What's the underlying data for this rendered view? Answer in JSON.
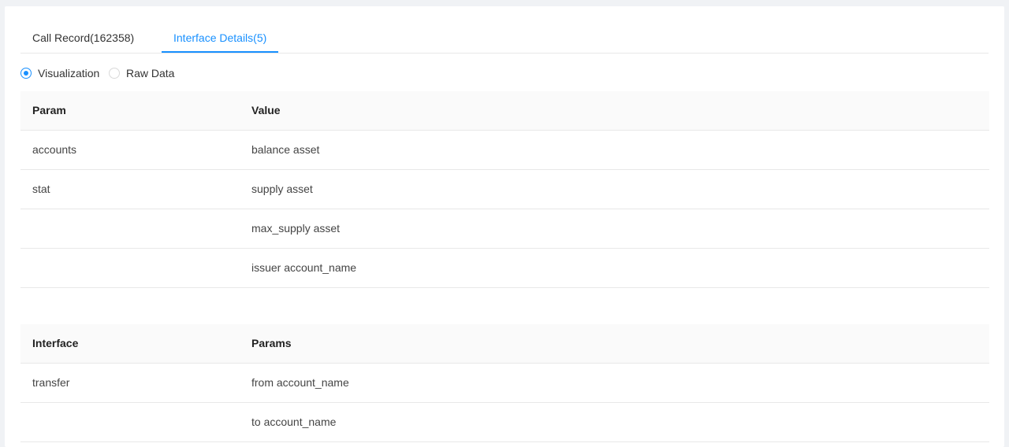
{
  "tabs": [
    {
      "label": "Call Record(162358)",
      "active": false
    },
    {
      "label": "Interface Details(5)",
      "active": true
    }
  ],
  "view_mode": {
    "options": [
      "Visualization",
      "Raw Data"
    ],
    "selected": "Visualization"
  },
  "params_table": {
    "headers": [
      "Param",
      "Value"
    ],
    "rows": [
      [
        "accounts",
        "balance asset"
      ],
      [
        "stat",
        "supply asset"
      ],
      [
        "",
        "max_supply asset"
      ],
      [
        "",
        "issuer account_name"
      ]
    ]
  },
  "interface_table": {
    "headers": [
      "Interface",
      "Params"
    ],
    "rows": [
      [
        "transfer",
        "from account_name"
      ],
      [
        "",
        "to account_name"
      ]
    ]
  },
  "colors": {
    "accent": "#1890ff",
    "background": "#f0f2f5",
    "header_bg": "#fafafa",
    "border": "#e8e8e8"
  }
}
